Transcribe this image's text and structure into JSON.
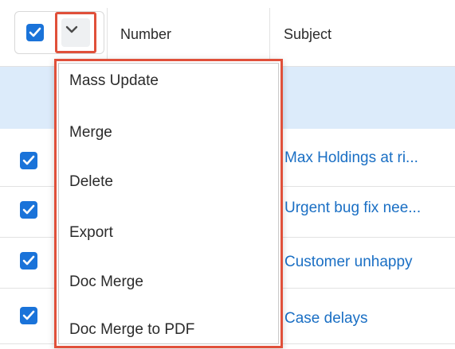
{
  "header": {
    "select_all_checked": true,
    "columns": [
      "Number",
      "Subject"
    ]
  },
  "rows": [
    {
      "checked": true,
      "subject": "Max Holdings at ri..."
    },
    {
      "checked": true,
      "subject": "Urgent bug fix nee..."
    },
    {
      "checked": true,
      "subject": "Customer unhappy"
    },
    {
      "checked": true,
      "subject": "Case delays"
    }
  ],
  "mass_actions_menu": {
    "items": [
      "Mass Update",
      "Merge",
      "Delete",
      "Export",
      "Doc Merge",
      "Doc Merge to PDF"
    ]
  },
  "colors": {
    "accent": "#1a73d9",
    "highlight_border": "#e0503a",
    "link": "#1a6fc4",
    "selected_band": "#dcebfa"
  },
  "icons": {
    "checkbox": "check-icon",
    "dropdown_toggle": "chevron-down-icon"
  }
}
